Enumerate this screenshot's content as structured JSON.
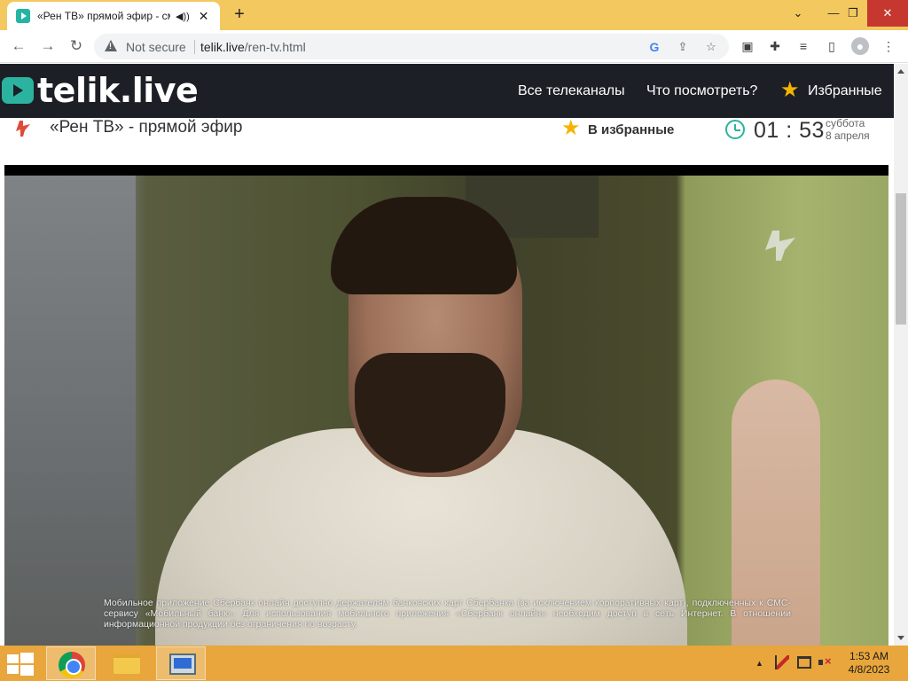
{
  "browser": {
    "tab": {
      "title": "«Рен ТВ» прямой эфир - смотреть онлайн",
      "audio_icon": "speaker-icon",
      "close_glyph": "✕"
    },
    "new_tab_glyph": "+",
    "window_controls": {
      "minimize": "⌄",
      "restore": "❐",
      "close": "✕"
    },
    "toolbar": {
      "back": "←",
      "forward": "→",
      "reload": "↻",
      "security_label": "Not secure",
      "url_host": "telik.live",
      "url_path": "/ren-tv.html",
      "google_glyph": "G",
      "share_glyph": "⇪",
      "bookmark_glyph": "☆",
      "ext1_glyph": "▣",
      "extensions_glyph": "✚",
      "media_glyph": "≡",
      "sidepanel_glyph": "▯",
      "profile_glyph": "●",
      "menu_glyph": "⋮"
    }
  },
  "site": {
    "logo_text": "telik.live",
    "nav": {
      "all_channels": "Все телеканалы",
      "what_to_watch": "Что посмотреть?",
      "favorites": "Избранные"
    },
    "channel": {
      "title": "«Рен ТВ» - прямой эфир",
      "add_favorite": "В избранные",
      "time": "01 : 53",
      "weekday": "суббота",
      "date": "8 апреля"
    },
    "player": {
      "disclaimer": "Мобильное приложение Сбербанк онлайн доступно держателям банковских карт Сбербанка (за исключением корпоративных карт), подключенных к СМС-сервису «Мобильный банк». Для использования мобильного приложения «Сбербанк онлайн» необходим доступ в сеть Интернет. В отношении информационной продукции без ограничения по возрасту."
    }
  },
  "taskbar": {
    "apps": [
      "Google Chrome",
      "File Explorer",
      "Computer"
    ],
    "tray_arrow": "▲",
    "time": "1:53 AM",
    "date": "4/8/2023"
  },
  "colors": {
    "tabstrip": "#f3c95f",
    "site_header": "#1d1f26",
    "accent_teal": "#2bb3a0",
    "star_gold": "#f5b400",
    "taskbar": "#e8a63c"
  }
}
